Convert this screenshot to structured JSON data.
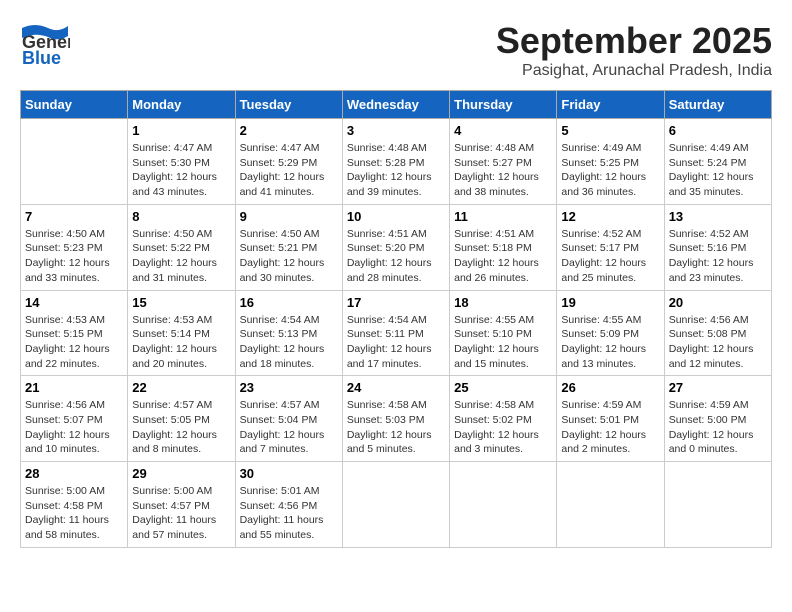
{
  "header": {
    "logo_general": "General",
    "logo_blue": "Blue",
    "month": "September 2025",
    "location": "Pasighat, Arunachal Pradesh, India"
  },
  "days_of_week": [
    "Sunday",
    "Monday",
    "Tuesday",
    "Wednesday",
    "Thursday",
    "Friday",
    "Saturday"
  ],
  "weeks": [
    [
      {
        "day": null,
        "sunrise": null,
        "sunset": null,
        "daylight": null
      },
      {
        "day": "1",
        "sunrise": "Sunrise: 4:47 AM",
        "sunset": "Sunset: 5:30 PM",
        "daylight": "Daylight: 12 hours and 43 minutes."
      },
      {
        "day": "2",
        "sunrise": "Sunrise: 4:47 AM",
        "sunset": "Sunset: 5:29 PM",
        "daylight": "Daylight: 12 hours and 41 minutes."
      },
      {
        "day": "3",
        "sunrise": "Sunrise: 4:48 AM",
        "sunset": "Sunset: 5:28 PM",
        "daylight": "Daylight: 12 hours and 39 minutes."
      },
      {
        "day": "4",
        "sunrise": "Sunrise: 4:48 AM",
        "sunset": "Sunset: 5:27 PM",
        "daylight": "Daylight: 12 hours and 38 minutes."
      },
      {
        "day": "5",
        "sunrise": "Sunrise: 4:49 AM",
        "sunset": "Sunset: 5:25 PM",
        "daylight": "Daylight: 12 hours and 36 minutes."
      },
      {
        "day": "6",
        "sunrise": "Sunrise: 4:49 AM",
        "sunset": "Sunset: 5:24 PM",
        "daylight": "Daylight: 12 hours and 35 minutes."
      }
    ],
    [
      {
        "day": "7",
        "sunrise": "Sunrise: 4:50 AM",
        "sunset": "Sunset: 5:23 PM",
        "daylight": "Daylight: 12 hours and 33 minutes."
      },
      {
        "day": "8",
        "sunrise": "Sunrise: 4:50 AM",
        "sunset": "Sunset: 5:22 PM",
        "daylight": "Daylight: 12 hours and 31 minutes."
      },
      {
        "day": "9",
        "sunrise": "Sunrise: 4:50 AM",
        "sunset": "Sunset: 5:21 PM",
        "daylight": "Daylight: 12 hours and 30 minutes."
      },
      {
        "day": "10",
        "sunrise": "Sunrise: 4:51 AM",
        "sunset": "Sunset: 5:20 PM",
        "daylight": "Daylight: 12 hours and 28 minutes."
      },
      {
        "day": "11",
        "sunrise": "Sunrise: 4:51 AM",
        "sunset": "Sunset: 5:18 PM",
        "daylight": "Daylight: 12 hours and 26 minutes."
      },
      {
        "day": "12",
        "sunrise": "Sunrise: 4:52 AM",
        "sunset": "Sunset: 5:17 PM",
        "daylight": "Daylight: 12 hours and 25 minutes."
      },
      {
        "day": "13",
        "sunrise": "Sunrise: 4:52 AM",
        "sunset": "Sunset: 5:16 PM",
        "daylight": "Daylight: 12 hours and 23 minutes."
      }
    ],
    [
      {
        "day": "14",
        "sunrise": "Sunrise: 4:53 AM",
        "sunset": "Sunset: 5:15 PM",
        "daylight": "Daylight: 12 hours and 22 minutes."
      },
      {
        "day": "15",
        "sunrise": "Sunrise: 4:53 AM",
        "sunset": "Sunset: 5:14 PM",
        "daylight": "Daylight: 12 hours and 20 minutes."
      },
      {
        "day": "16",
        "sunrise": "Sunrise: 4:54 AM",
        "sunset": "Sunset: 5:13 PM",
        "daylight": "Daylight: 12 hours and 18 minutes."
      },
      {
        "day": "17",
        "sunrise": "Sunrise: 4:54 AM",
        "sunset": "Sunset: 5:11 PM",
        "daylight": "Daylight: 12 hours and 17 minutes."
      },
      {
        "day": "18",
        "sunrise": "Sunrise: 4:55 AM",
        "sunset": "Sunset: 5:10 PM",
        "daylight": "Daylight: 12 hours and 15 minutes."
      },
      {
        "day": "19",
        "sunrise": "Sunrise: 4:55 AM",
        "sunset": "Sunset: 5:09 PM",
        "daylight": "Daylight: 12 hours and 13 minutes."
      },
      {
        "day": "20",
        "sunrise": "Sunrise: 4:56 AM",
        "sunset": "Sunset: 5:08 PM",
        "daylight": "Daylight: 12 hours and 12 minutes."
      }
    ],
    [
      {
        "day": "21",
        "sunrise": "Sunrise: 4:56 AM",
        "sunset": "Sunset: 5:07 PM",
        "daylight": "Daylight: 12 hours and 10 minutes."
      },
      {
        "day": "22",
        "sunrise": "Sunrise: 4:57 AM",
        "sunset": "Sunset: 5:05 PM",
        "daylight": "Daylight: 12 hours and 8 minutes."
      },
      {
        "day": "23",
        "sunrise": "Sunrise: 4:57 AM",
        "sunset": "Sunset: 5:04 PM",
        "daylight": "Daylight: 12 hours and 7 minutes."
      },
      {
        "day": "24",
        "sunrise": "Sunrise: 4:58 AM",
        "sunset": "Sunset: 5:03 PM",
        "daylight": "Daylight: 12 hours and 5 minutes."
      },
      {
        "day": "25",
        "sunrise": "Sunrise: 4:58 AM",
        "sunset": "Sunset: 5:02 PM",
        "daylight": "Daylight: 12 hours and 3 minutes."
      },
      {
        "day": "26",
        "sunrise": "Sunrise: 4:59 AM",
        "sunset": "Sunset: 5:01 PM",
        "daylight": "Daylight: 12 hours and 2 minutes."
      },
      {
        "day": "27",
        "sunrise": "Sunrise: 4:59 AM",
        "sunset": "Sunset: 5:00 PM",
        "daylight": "Daylight: 12 hours and 0 minutes."
      }
    ],
    [
      {
        "day": "28",
        "sunrise": "Sunrise: 5:00 AM",
        "sunset": "Sunset: 4:58 PM",
        "daylight": "Daylight: 11 hours and 58 minutes."
      },
      {
        "day": "29",
        "sunrise": "Sunrise: 5:00 AM",
        "sunset": "Sunset: 4:57 PM",
        "daylight": "Daylight: 11 hours and 57 minutes."
      },
      {
        "day": "30",
        "sunrise": "Sunrise: 5:01 AM",
        "sunset": "Sunset: 4:56 PM",
        "daylight": "Daylight: 11 hours and 55 minutes."
      },
      {
        "day": null,
        "sunrise": null,
        "sunset": null,
        "daylight": null
      },
      {
        "day": null,
        "sunrise": null,
        "sunset": null,
        "daylight": null
      },
      {
        "day": null,
        "sunrise": null,
        "sunset": null,
        "daylight": null
      },
      {
        "day": null,
        "sunrise": null,
        "sunset": null,
        "daylight": null
      }
    ]
  ]
}
